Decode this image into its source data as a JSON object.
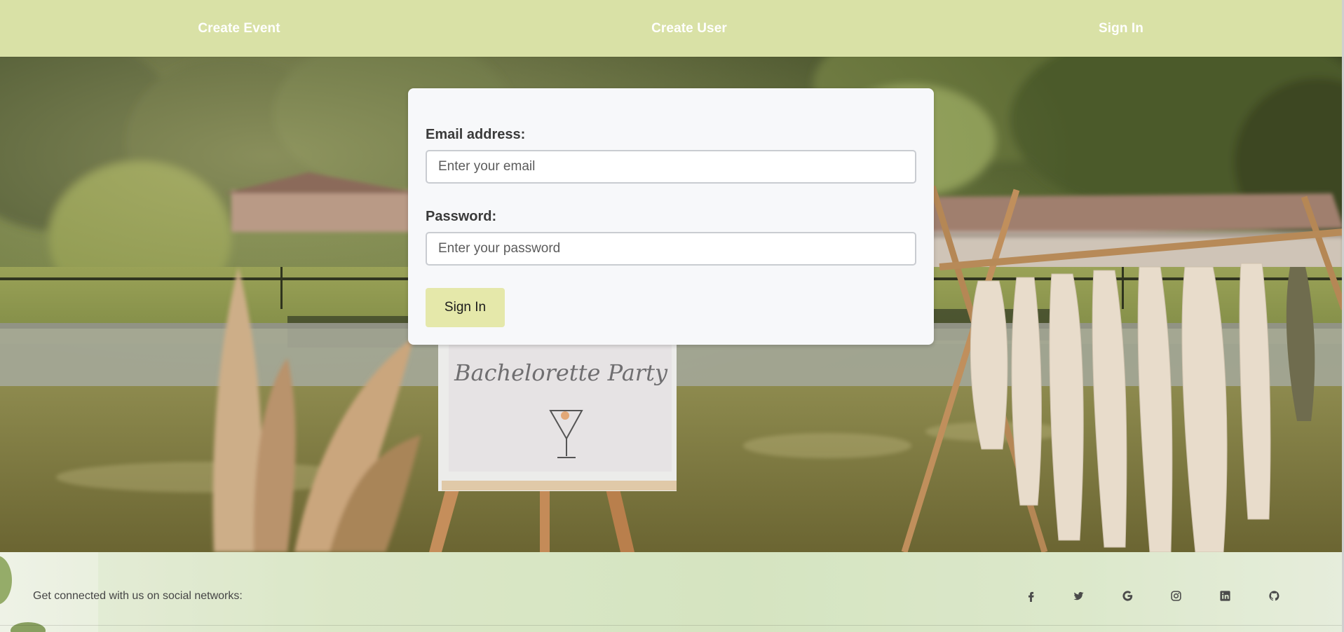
{
  "nav": {
    "items": [
      {
        "label": "Create Event"
      },
      {
        "label": "Create User"
      },
      {
        "label": "Sign In"
      }
    ]
  },
  "form": {
    "email_label": "Email address:",
    "email_placeholder": "Enter your email",
    "email_value": "",
    "password_label": "Password:",
    "password_placeholder": "Enter your password",
    "password_value": "",
    "submit_label": "Sign In"
  },
  "hero": {
    "sign_text": "Bachelorette Party"
  },
  "footer": {
    "social_text": "Get connected with us on social networks:",
    "icons": [
      "facebook-icon",
      "twitter-icon",
      "google-icon",
      "instagram-icon",
      "linkedin-icon",
      "github-icon"
    ]
  },
  "colors": {
    "nav_bg": "#d9e1a6",
    "button_bg": "#e5e8aa",
    "card_bg": "#f7f8fa"
  }
}
